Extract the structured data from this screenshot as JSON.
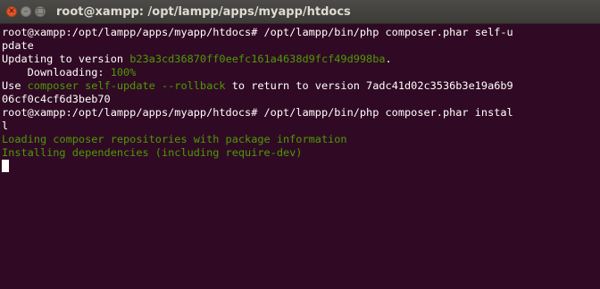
{
  "window": {
    "title": "root@xampp: /opt/lampp/apps/myapp/htdocs",
    "close_glyph": "✕",
    "min_glyph": "–",
    "max_glyph": "□"
  },
  "terminal": {
    "lines": [
      {
        "segments": [
          {
            "text": "root@xampp:/opt/lampp/apps/myapp/htdocs# /opt/lampp/bin/php composer.phar self-u"
          }
        ]
      },
      {
        "segments": [
          {
            "text": "pdate"
          }
        ]
      },
      {
        "segments": [
          {
            "text": "Updating to version "
          },
          {
            "text": "b23a3cd36870ff0eefc161a4638d9fcf49d998ba",
            "color": "green"
          },
          {
            "text": "."
          }
        ]
      },
      {
        "segments": [
          {
            "text": "    Downloading: "
          },
          {
            "text": "100%",
            "color": "green"
          }
        ]
      },
      {
        "segments": [
          {
            "text": "Use "
          },
          {
            "text": "composer self-update --rollback",
            "color": "green"
          },
          {
            "text": " to return to version 7adc41d02c3536b3e19a6b9"
          }
        ]
      },
      {
        "segments": [
          {
            "text": "06cf0c4cf6d3beb70"
          }
        ]
      },
      {
        "segments": [
          {
            "text": "root@xampp:/opt/lampp/apps/myapp/htdocs# /opt/lampp/bin/php composer.phar instal"
          }
        ]
      },
      {
        "segments": [
          {
            "text": "l"
          }
        ]
      },
      {
        "segments": [
          {
            "text": "Loading composer repositories with package information",
            "color": "green"
          }
        ]
      },
      {
        "segments": [
          {
            "text": "Installing dependencies (including require-dev)",
            "color": "green"
          }
        ]
      }
    ]
  },
  "colors": {
    "background": "#300a24",
    "text": "#ffffff",
    "green": "#4e9a06"
  }
}
